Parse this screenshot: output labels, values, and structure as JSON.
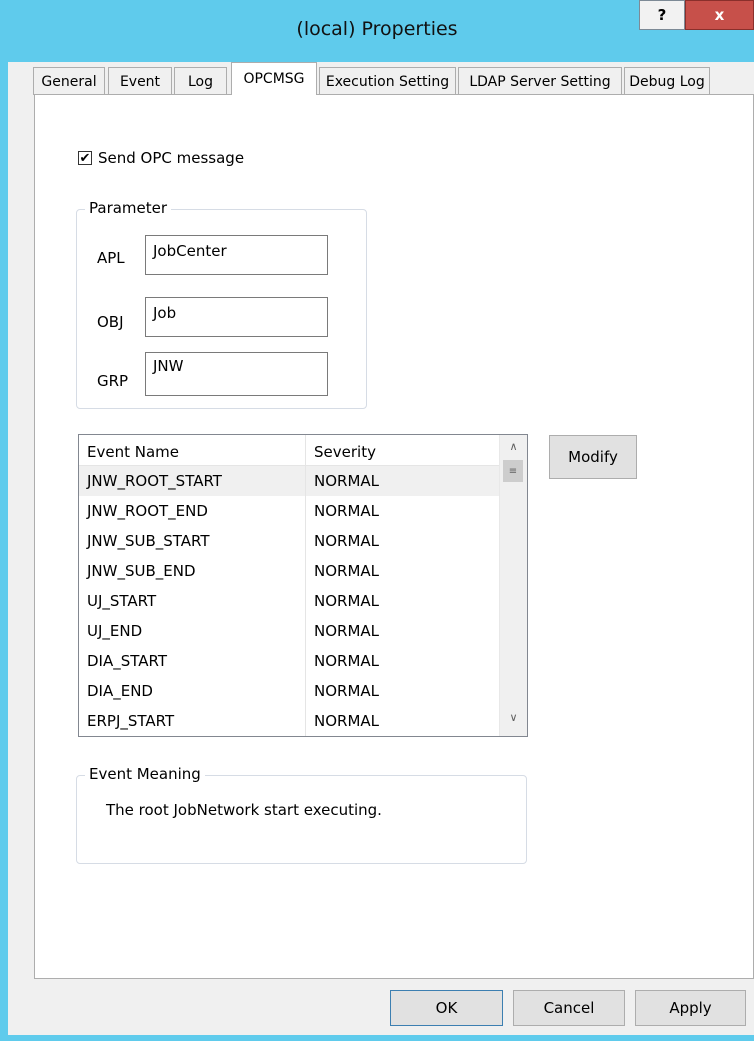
{
  "window": {
    "title": "(local) Properties",
    "help_label": "?",
    "close_label": "x"
  },
  "tabs": [
    {
      "label": "General",
      "active": false
    },
    {
      "label": "Event",
      "active": false
    },
    {
      "label": "Log",
      "active": false
    },
    {
      "label": "OPCMSG",
      "active": true
    },
    {
      "label": "Execution Setting",
      "active": false
    },
    {
      "label": "LDAP Server Setting",
      "active": false
    },
    {
      "label": "Debug Log",
      "active": false
    }
  ],
  "send_opc": {
    "checked": true,
    "check_glyph": "✔",
    "label": "Send OPC message"
  },
  "parameter": {
    "legend": "Parameter",
    "apl_label": "APL",
    "apl_value": "JobCenter",
    "obj_label": "OBJ",
    "obj_value": "Job",
    "grp_label": "GRP",
    "grp_value": "JNW"
  },
  "event_list": {
    "columns": [
      "Event Name",
      "Severity"
    ],
    "rows": [
      {
        "name": "JNW_ROOT_START",
        "severity": "NORMAL",
        "selected": true
      },
      {
        "name": "JNW_ROOT_END",
        "severity": "NORMAL"
      },
      {
        "name": "JNW_SUB_START",
        "severity": "NORMAL"
      },
      {
        "name": "JNW_SUB_END",
        "severity": "NORMAL"
      },
      {
        "name": "UJ_START",
        "severity": "NORMAL"
      },
      {
        "name": "UJ_END",
        "severity": "NORMAL"
      },
      {
        "name": "DIA_START",
        "severity": "NORMAL"
      },
      {
        "name": "DIA_END",
        "severity": "NORMAL"
      },
      {
        "name": "ERPJ_START",
        "severity": "NORMAL"
      }
    ]
  },
  "modify_label": "Modify",
  "event_meaning": {
    "legend": "Event Meaning",
    "text": "The root JobNetwork start executing."
  },
  "footer": {
    "ok": "OK",
    "cancel": "Cancel",
    "apply": "Apply"
  },
  "colors": {
    "titlebar": "#5fcbec",
    "close": "#c7504a",
    "dialog_bg": "#f0f0f0"
  }
}
